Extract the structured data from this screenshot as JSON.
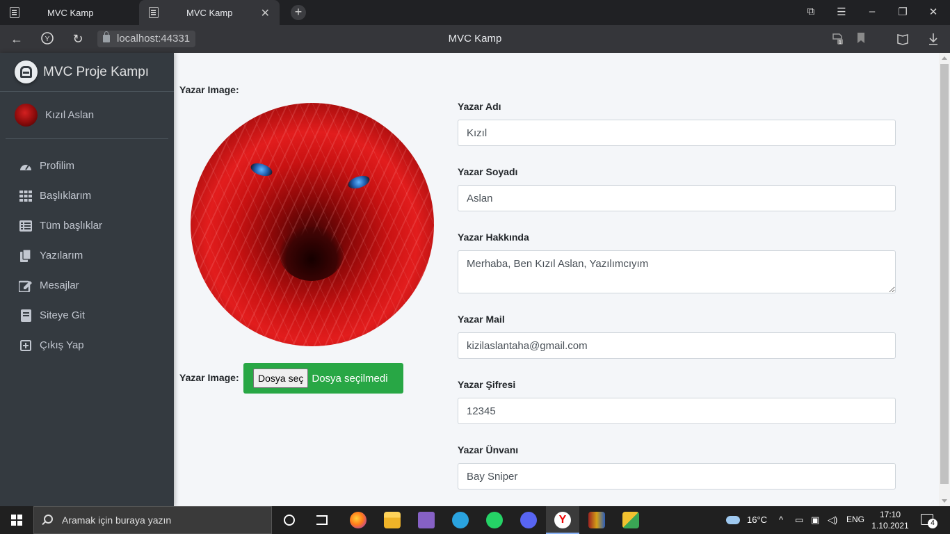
{
  "browser": {
    "tabs": [
      {
        "title": "MVC Kamp",
        "active": false
      },
      {
        "title": "MVC Kamp",
        "active": true
      }
    ],
    "new_tab_symbol": "+",
    "url": "localhost:44331",
    "page_title": "MVC Kamp",
    "extension_badge": "1"
  },
  "sidebar": {
    "brand": "MVC Proje Kampı",
    "user_name": "Kızıl Aslan",
    "items": [
      {
        "label": "Profilim",
        "icon": "tachometer-icon"
      },
      {
        "label": "Başlıklarım",
        "icon": "grid-icon"
      },
      {
        "label": "Tüm başlıklar",
        "icon": "list-icon"
      },
      {
        "label": "Yazılarım",
        "icon": "copy-icon"
      },
      {
        "label": "Mesajlar",
        "icon": "edit-icon"
      },
      {
        "label": "Siteye Git",
        "icon": "book-icon"
      },
      {
        "label": "Çıkış Yap",
        "icon": "plus-square-icon"
      }
    ]
  },
  "form": {
    "image_label": "Yazar Image:",
    "image_upload_label": "Yazar Image:",
    "file_button": "Dosya seç",
    "file_status": "Dosya seçilmedi",
    "fields": [
      {
        "label": "Yazar Adı",
        "value": "Kızıl"
      },
      {
        "label": "Yazar Soyadı",
        "value": "Aslan"
      },
      {
        "label": "Yazar Hakkında",
        "value": "Merhaba, Ben Kızıl Aslan, Yazılımcıyım"
      },
      {
        "label": "Yazar Mail",
        "value": "kizilaslantaha@gmail.com"
      },
      {
        "label": "Yazar Şifresi",
        "value": "12345"
      },
      {
        "label": "Yazar Ünvanı",
        "value": "Bay Sniper"
      }
    ]
  },
  "taskbar": {
    "search_placeholder": "Aramak için buraya yazın",
    "temperature": "16°C",
    "language": "ENG",
    "time": "17:10",
    "date": "1.10.2021",
    "notification_count": "4"
  },
  "colors": {
    "sidebar_bg": "#343a40",
    "content_bg": "#f4f6f9",
    "upload_bg": "#28a745"
  }
}
